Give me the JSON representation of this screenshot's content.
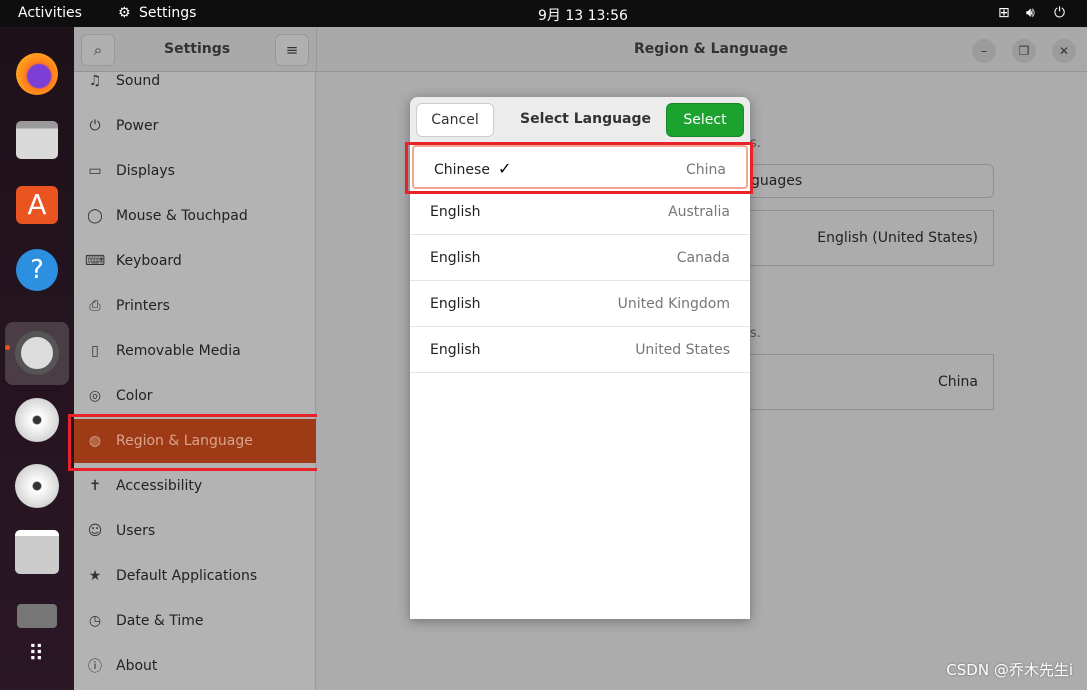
{
  "topbar": {
    "activities": "Activities",
    "app": "Settings",
    "clock": "9月 13  13:56"
  },
  "dock": {
    "apps": [
      "firefox",
      "files",
      "software",
      "help",
      "settings",
      "disc",
      "disc",
      "floppy",
      "drive",
      "app-grid"
    ]
  },
  "header": {
    "sidebar_title": "Settings",
    "title": "Region & Language"
  },
  "sidebar": {
    "items": [
      {
        "label": "Sound",
        "icon": "♫"
      },
      {
        "label": "Power",
        "icon": "⏻"
      },
      {
        "label": "Displays",
        "icon": "▭"
      },
      {
        "label": "Mouse & Touchpad",
        "icon": "◯"
      },
      {
        "label": "Keyboard",
        "icon": "⌨"
      },
      {
        "label": "Printers",
        "icon": "⎙"
      },
      {
        "label": "Removable Media",
        "icon": "▯"
      },
      {
        "label": "Color",
        "icon": "◎"
      },
      {
        "label": "Region & Language",
        "icon": "◍"
      },
      {
        "label": "Accessibility",
        "icon": "✝"
      },
      {
        "label": "Users",
        "icon": "☺"
      },
      {
        "label": "Default Applications",
        "icon": "★"
      },
      {
        "label": "Date & Time",
        "icon": "◷"
      },
      {
        "label": "About",
        "icon": "ⓘ"
      }
    ]
  },
  "main": {
    "frag1": "s.",
    "frag2": "guages",
    "formats_value": "English (United States)",
    "frag3": "s.",
    "region_value": "China"
  },
  "dialog": {
    "cancel": "Cancel",
    "title": "Select Language",
    "select": "Select",
    "rows": [
      {
        "lang": "Chinese",
        "region": "China",
        "selected": true
      },
      {
        "lang": "English",
        "region": "Australia"
      },
      {
        "lang": "English",
        "region": "Canada"
      },
      {
        "lang": "English",
        "region": "United Kingdom"
      },
      {
        "lang": "English",
        "region": "United States"
      }
    ]
  },
  "watermark": "CSDN @乔木先生i",
  "colors": {
    "accent": "#9e3a16",
    "select": "#1ca22e",
    "highlight": "#e8222a"
  }
}
